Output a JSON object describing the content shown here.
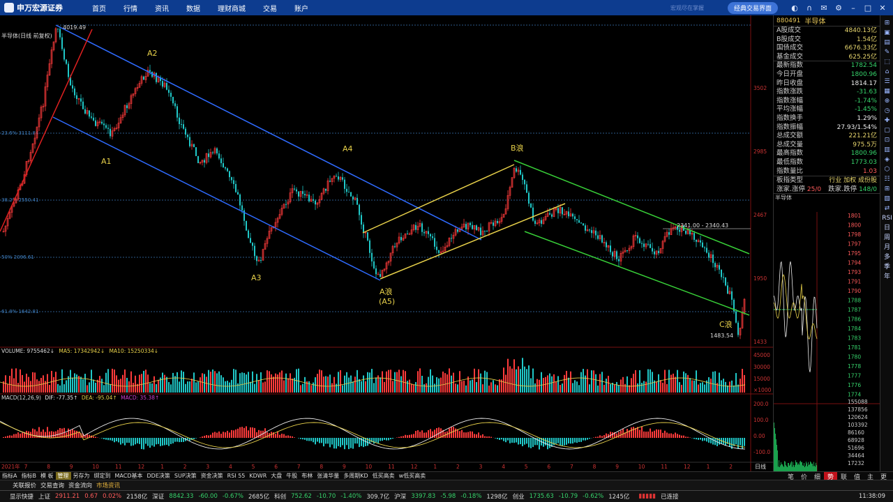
{
  "app": {
    "logo_text": "申万宏源证券",
    "slogan": "宏观尽在掌握",
    "classic_button": "经典交易界面"
  },
  "nav": [
    "首页",
    "行情",
    "资讯",
    "数据",
    "理财商城",
    "交易",
    "账户"
  ],
  "chart": {
    "title": "半导体(日线 前复权)",
    "labels": {
      "high": "4019.49",
      "A1": "A1",
      "A2": "A2",
      "A3": "A3",
      "A4": "A4",
      "Awave1": "A浪",
      "Awave2": "(A5)",
      "Bwave": "B浪",
      "Cwave": "C浪",
      "low": "1483.54",
      "range": "2341.00 - 2340.43"
    },
    "fib": [
      "23.6% 3111.84",
      "38.2% 2550.41",
      "50% 2096.61",
      "61.8% 1642.81"
    ],
    "price_ticks": [
      "3502",
      "2985",
      "2467",
      "1950",
      "1433"
    ],
    "volume_title": "VOLUME: 9755462↓",
    "volume_ma5": "MA5: 17342942↓",
    "volume_ma10": "MA10: 15250334↓",
    "volume_ticks": [
      "45000",
      "30000",
      "15000",
      "×1000"
    ],
    "macd_title": "MACD(12,26,9)",
    "macd_dif": "DIF: -77.35↑",
    "macd_dea": "DEA: -95.04↑",
    "macd_val": "MACD: 35.38↑",
    "macd_ticks": [
      "200.0",
      "100.0",
      "0.00",
      "-100.0"
    ],
    "dates": [
      "2021年",
      "7",
      "8",
      "9",
      "10",
      "11",
      "12",
      "1",
      "2",
      "3",
      "4",
      "5",
      "6",
      "7",
      "8",
      "9",
      "10",
      "11",
      "12",
      "1",
      "2",
      "3",
      "4",
      "5",
      "6",
      "7",
      "8",
      "9",
      "10",
      "11",
      "12",
      "1",
      "2"
    ],
    "period": "日线"
  },
  "panel": {
    "code": "880491",
    "name": "半导体",
    "stats": [
      {
        "label": "A股成交",
        "value": "4840.13亿",
        "color": "yellow"
      },
      {
        "label": "B股成交",
        "value": "1.54亿",
        "color": "yellow"
      },
      {
        "label": "国债成交",
        "value": "6676.33亿",
        "color": "yellow"
      },
      {
        "label": "基金成交",
        "value": "625.25亿",
        "color": "yellow"
      },
      {
        "label": "最新指数",
        "value": "1782.54",
        "color": "green"
      },
      {
        "label": "今日开盘",
        "value": "1800.96",
        "color": "green"
      },
      {
        "label": "昨日收盘",
        "value": "1814.17",
        "color": "white"
      },
      {
        "label": "指数涨跌",
        "value": "-31.63",
        "color": "green"
      },
      {
        "label": "指数涨幅",
        "value": "-1.74%",
        "color": "green"
      },
      {
        "label": "平均涨幅",
        "value": "-1.45%",
        "color": "green"
      },
      {
        "label": "指数换手",
        "value": "1.29%",
        "color": "white"
      },
      {
        "label": "指数振幅",
        "value": "27.93/1.54%",
        "color": "white"
      },
      {
        "label": "总成交额",
        "value": "221.21亿",
        "color": "yellow"
      },
      {
        "label": "总成交量",
        "value": "975.5万",
        "color": "yellow"
      },
      {
        "label": "最高指数",
        "value": "1800.96",
        "color": "green"
      },
      {
        "label": "最低指数",
        "value": "1773.03",
        "color": "green"
      },
      {
        "label": "指数量比",
        "value": "1.03",
        "color": "red"
      }
    ],
    "board_type": "板指类型",
    "board_value": "行业 加权 成份股",
    "limit_label": "涨家.涨停",
    "limit_value": "25/0",
    "fall_label": "跌家.跌停",
    "fall_value": "148/0",
    "mini_title": "半导体",
    "mini_ticks": [
      "1801",
      "1800",
      "1798",
      "1797",
      "1795",
      "1794",
      "1793",
      "1791",
      "1790",
      "1788",
      "1787",
      "1786",
      "1784",
      "1783",
      "1781",
      "1780",
      "1778",
      "1777",
      "1776",
      "1774"
    ],
    "mini_vol_ticks": [
      "155088",
      "137856",
      "120624",
      "103392",
      "86160",
      "68928",
      "51696",
      "34464",
      "17232"
    ],
    "tabs": [
      "笔",
      "价",
      "细",
      "势",
      "联",
      "值",
      "主",
      "更"
    ]
  },
  "side_icons": [
    "RSI",
    "日",
    "周",
    "月",
    "多",
    "季",
    "年"
  ],
  "bottom_tabs": [
    "指标A",
    "指标B",
    "模 板",
    "管理",
    "另存为",
    "绑定到",
    "MACD基本",
    "DDE决策",
    "SUP决策",
    "资金决策",
    "RSI 55",
    "KDWR",
    "大盘",
    "牛股",
    "布林",
    "张清华量",
    "多周期KD",
    "低买高卖",
    "w低买高卖"
  ],
  "sub_tabs": [
    "关联报价",
    "交易查询",
    "资金流向",
    "市场资讯"
  ],
  "status": {
    "label": "显示快捷",
    "sh": "上证",
    "sh_val": "2911.21",
    "sh_chg": "0.67",
    "sh_pct": "0.02%",
    "sh_amt": "2158亿",
    "sz": "深证",
    "sz_val": "8842.33",
    "sz_chg": "-60.00",
    "sz_pct": "-0.67%",
    "sz_amt": "2685亿",
    "kc": "科创",
    "kc_val": "752.62",
    "kc_chg": "-10.70",
    "kc_pct": "-1.40%",
    "kc_amt": "309.7亿",
    "hs": "沪深",
    "hs_val": "3397.83",
    "hs_chg": "-5.98",
    "hs_pct": "-0.18%",
    "hs_amt": "1298亿",
    "cy": "创业",
    "cy_val": "1735.63",
    "cy_chg": "-10.79",
    "cy_pct": "-0.62%",
    "cy_amt": "1245亿",
    "conn": "已连接",
    "time": "11:38:09"
  }
}
